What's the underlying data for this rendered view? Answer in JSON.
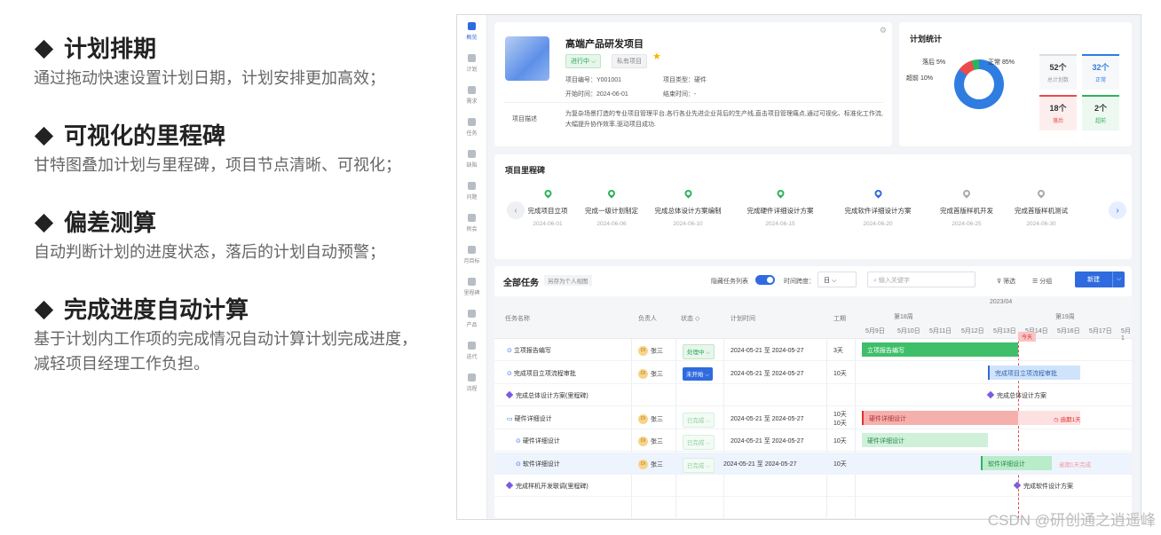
{
  "features": [
    {
      "title": "计划排期",
      "desc": "通过拖动快速设置计划日期，计划安排更加高效；"
    },
    {
      "title": "可视化的里程碑",
      "desc": "甘特图叠加计划与里程碑，项目节点清晰、可视化；"
    },
    {
      "title": "偏差测算",
      "desc": "自动判断计划的进度状态，落后的计划自动预警；"
    },
    {
      "title": "完成进度自动计算",
      "desc": "基于计划内工作项的完成情况自动计算计划完成进度，减轻项目经理工作负担。"
    }
  ],
  "sidebar": [
    "概览",
    "计划",
    "需求",
    "任务",
    "缺陷",
    "问题",
    "例会",
    "月目标",
    "里程碑",
    "产品",
    "迭代",
    "流程"
  ],
  "project": {
    "title": "高端产品研发项目",
    "status": "进行中 ⌵",
    "privacy": "私有项目",
    "code": "项目编号：Y001001",
    "type": "项目类型：硬件",
    "start": "开始时间：2024-06-01",
    "end": "结束时间：-",
    "desc_label": "项目描述",
    "desc": "为复杂场景打造的专业项目管理平台,各行各业先进企业背后的生产线,直击项目管理痛点,通过可视化、标准化工作流,大幅提升协作效率,驱动项目成功."
  },
  "stats": {
    "title": "计划统计",
    "late": "落后 5%",
    "normal": "正常 85%",
    "overdue": "超前 10%",
    "total_value": "52个",
    "total_label": "总计划数",
    "normal_value": "32个",
    "normal_label": "正常",
    "late_value": "18个",
    "late_label": "落后",
    "ahead_value": "2个",
    "ahead_label": "超前",
    "colors": {
      "normal": "#2f7de1",
      "late": "#ea4b4b",
      "ahead": "#2eb35d"
    }
  },
  "milestones": {
    "title": "项目里程碑",
    "items": [
      {
        "name": "完成项目立项",
        "date": "2024-06-01",
        "color": "#2eb35d"
      },
      {
        "name": "完成一级计划制定",
        "date": "2024-06-06",
        "color": "#2eb35d"
      },
      {
        "name": "完成总体设计方案编制",
        "date": "2024-06-10",
        "color": "#2eb35d"
      },
      {
        "name": "完成硬件详细设计方案",
        "date": "2024-06-15",
        "color": "#2eb35d"
      },
      {
        "name": "完成软件详细设计方案",
        "date": "2024-06-20",
        "color": "#2f6bdf"
      },
      {
        "name": "完成首版样机开发",
        "date": "2024-06-25",
        "color": "#aaaaaa"
      },
      {
        "name": "完成首版样机测试",
        "date": "2024-06-30",
        "color": "#aaaaaa"
      }
    ]
  },
  "toolbar": {
    "title": "全部任务",
    "save_view": "另存为个人视图",
    "hide_list": "隐藏任务列表",
    "span_label": "时间跨度：",
    "span_value": "日 ⌵",
    "search_placeholder": "输入关键字",
    "filter": "筛选",
    "group": "分组",
    "new": "新建"
  },
  "table": {
    "headers": [
      "任务名称",
      "负责人",
      "状态 ◇",
      "计划时间",
      "工期"
    ],
    "month": "2023/04",
    "week18": "第18周",
    "week19": "第19周",
    "days": [
      "5月9日",
      "5月10日",
      "5月11日",
      "5月12日",
      "5月13日",
      "5月14日",
      "5月16日",
      "5月17日",
      "5月1"
    ],
    "today": "今天",
    "rows": [
      {
        "name": "立项报告编写",
        "owner": "张三",
        "status": "处理中 ⌵",
        "time": "2024-05-21 至 2024-05-27",
        "dur": "3天",
        "bar": "立项报告编写"
      },
      {
        "name": "完成项目立项流程审批",
        "owner": "张三",
        "status": "未开始 ⌵",
        "time": "2024-05-21 至 2024-05-27",
        "dur": "10天",
        "bar": "完成项目立项流程审批"
      },
      {
        "name": "完成总体设计方案(里程碑)",
        "bar": "完成总体设计方案"
      },
      {
        "name": "硬件详细设计",
        "owner": "张三",
        "status": "已完成 ⌵",
        "time": "2024-05-21 至 2024-05-27",
        "dur": "10天",
        "dur2": "10天",
        "bar": "硬件详细设计",
        "flag": "◷ 逾期1天"
      },
      {
        "name": "硬件详细设计",
        "owner": "张三",
        "status": "已完成 ⌵",
        "time": "2024-05-21 至 2024-05-27",
        "dur": "10天",
        "bar": "硬件详细设计"
      },
      {
        "name": "软件详细设计",
        "owner": "张三",
        "status": "已完成 ⌵",
        "time": "2024-05-21 至 2024-05-27",
        "dur": "10天",
        "bar": "软件详细设计",
        "flag": "逾期1天完成"
      },
      {
        "name": "完成样机开发联调(里程碑)",
        "bar": "完成软件设计方案"
      }
    ]
  },
  "watermark": "CSDN @研创通之逍遥峰"
}
